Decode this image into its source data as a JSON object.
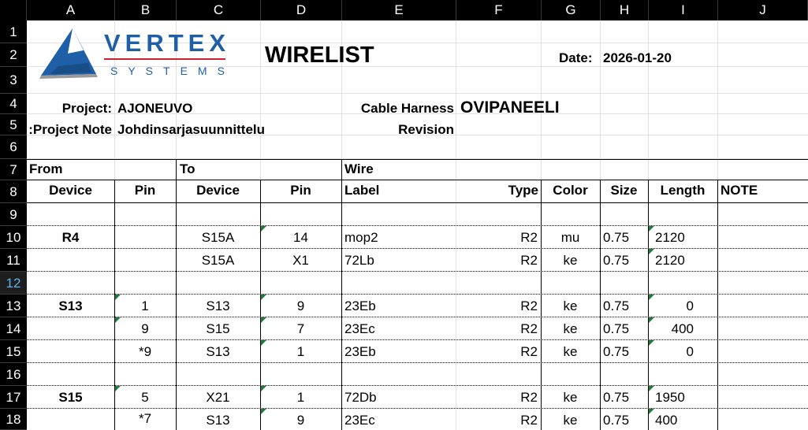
{
  "columns": [
    "A",
    "B",
    "C",
    "D",
    "E",
    "F",
    "G",
    "H",
    "I",
    "J"
  ],
  "rows": [
    "1",
    "2",
    "3",
    "4",
    "5",
    "6",
    "7",
    "8",
    "9",
    "10",
    "11",
    "12",
    "13",
    "14",
    "15",
    "16",
    "17",
    "18"
  ],
  "selected_row": "12",
  "logo": {
    "line1": "VERTEX",
    "line2": "SYSTEMS"
  },
  "sheet": {
    "title": "WIRELIST",
    "date_label": "Date:",
    "date_value": "2026-01-20",
    "project_label": "Project:",
    "project_value": "AJONEUVO",
    "project_note_label": "Project Note:",
    "project_note_value": "Johdinsarjasuunnittelu",
    "cable_harness_label": "Cable Harness",
    "cable_harness_value": "OVIPANEELI",
    "revision_label": "Revision",
    "group_from": "From",
    "group_to": "To",
    "group_wire": "Wire"
  },
  "headers": {
    "from_device": "Device",
    "from_pin": "Pin",
    "to_device": "Device",
    "to_pin": "Pin",
    "label": "Label",
    "type": "Type",
    "color": "Color",
    "size": "Size",
    "length": "Length",
    "note": "NOTE"
  },
  "wires": [
    {
      "from_device": "R4",
      "from_pin": "",
      "to_device": "S15A",
      "to_pin": "14",
      "label": "mop2",
      "type": "R2",
      "color": "mu",
      "size": "0.75",
      "length": "2120"
    },
    {
      "from_device": "",
      "from_pin": "",
      "to_device": "S15A",
      "to_pin": "X1",
      "label": "72Lb",
      "type": "R2",
      "color": "ke",
      "size": "0.75",
      "length": "2120"
    },
    {
      "from_device": "S13",
      "from_pin": "1",
      "to_device": "S13",
      "to_pin": "9",
      "label": "23Eb",
      "type": "R2",
      "color": "ke",
      "size": "0.75",
      "length": "0"
    },
    {
      "from_device": "",
      "from_pin": "9",
      "to_device": "S15",
      "to_pin": "7",
      "label": "23Ec",
      "type": "R2",
      "color": "ke",
      "size": "0.75",
      "length": "400"
    },
    {
      "from_device": "",
      "from_pin": "*9",
      "to_device": "S13",
      "to_pin": "1",
      "label": "23Eb",
      "type": "R2",
      "color": "ke",
      "size": "0.75",
      "length": "0"
    },
    {
      "from_device": "S15",
      "from_pin": "5",
      "to_device": "X21",
      "to_pin": "1",
      "label": "72Db",
      "type": "R2",
      "color": "ke",
      "size": "0.75",
      "length": "1950"
    },
    {
      "from_device": "",
      "from_pin": "*7",
      "to_device": "S13",
      "to_pin": "9",
      "label": "23Ec",
      "type": "R2",
      "color": "ke",
      "size": "0.75",
      "length": "400"
    }
  ]
}
